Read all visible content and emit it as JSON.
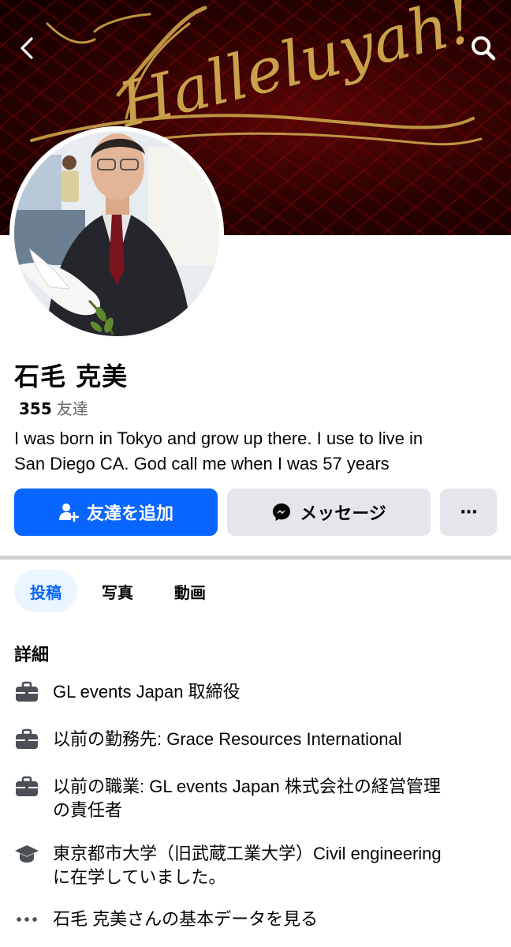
{
  "cover": {
    "script_text": "Halleluyah!",
    "colors": {
      "background": "#3a0404",
      "script": "#c9a14a"
    }
  },
  "header": {
    "back_icon": "chevron-left-icon",
    "search_icon": "search-icon"
  },
  "profile": {
    "name": "石毛 克美",
    "friends_count": "355",
    "friends_label": "友達",
    "bio_lines": [
      "I was born in Tokyo and grow up there. I use to live in",
      "San Diego CA. God call me when I was 57 years"
    ]
  },
  "actions": {
    "add_friend": "友達を追加",
    "message": "メッセージ",
    "more": "···"
  },
  "tabs": [
    {
      "label": "投稿",
      "active": true
    },
    {
      "label": "写真",
      "active": false
    },
    {
      "label": "動画",
      "active": false
    }
  ],
  "details": {
    "title": "詳細",
    "items": [
      {
        "icon": "briefcase-icon",
        "lines": [
          "GL events Japan 取締役"
        ]
      },
      {
        "icon": "briefcase-icon",
        "lines": [
          "以前の勤務先: Grace Resources International"
        ]
      },
      {
        "icon": "briefcase-icon",
        "lines": [
          "以前の職業: GL events Japan 株式会社の経営管理",
          "の責任者"
        ]
      },
      {
        "icon": "graduation-cap-icon",
        "lines": [
          "東京都市大学（旧武蔵工業大学）Civil engineering",
          "に在学していました。"
        ]
      },
      {
        "icon": "ellipsis-icon",
        "lines": [
          "石毛 克美さんの基本データを見る"
        ]
      }
    ]
  },
  "colors": {
    "primary": "#0866ff",
    "secondary_button": "#e4e6eb",
    "active_tab_bg": "#ebf5ff",
    "muted_text": "#65676b",
    "divider": "#ced0d4"
  }
}
